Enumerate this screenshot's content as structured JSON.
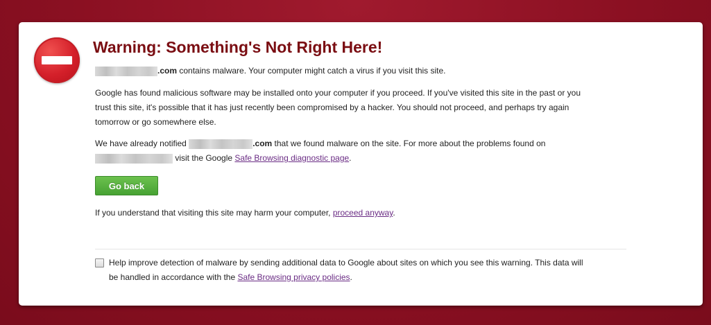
{
  "colors": {
    "background": "#8b1022",
    "title": "#7a0d12",
    "button": "#52a83b",
    "link": "#6a2c84"
  },
  "warning": {
    "icon": "stop-icon",
    "title": "Warning: Something's Not Right Here!",
    "line1_suffix": ".com",
    "line1_text": " contains malware. Your computer might catch a virus if you visit this site.",
    "para1_line1": "Google has found malicious software may be installed onto your computer if you proceed. If you've visited this site in the past or you",
    "para1_line2": "trust this site, it's possible that it has just recently been compromised by a hacker. You should not proceed, and perhaps try again",
    "para1_line3": "tomorrow or go somewhere else.",
    "para2_prefix": "We have already notified ",
    "para2_domain_suffix": ".com",
    "para2_middle": " that we found malware on the site. For more about the problems found on",
    "para2_line2_text": " visit the Google ",
    "diagnostic_link": "Safe Browsing diagnostic page",
    "para2_end": ".",
    "go_back_label": "Go back",
    "proceed_prefix": "If you understand that visiting this site may harm your computer, ",
    "proceed_link": "proceed anyway",
    "proceed_end": "."
  },
  "report": {
    "checked": false,
    "line1": "Help improve detection of malware by sending additional data to Google about sites on which you see this warning. This data will",
    "line2_prefix": "be handled in accordance with the ",
    "privacy_link": "Safe Browsing privacy policies",
    "line2_end": "."
  }
}
